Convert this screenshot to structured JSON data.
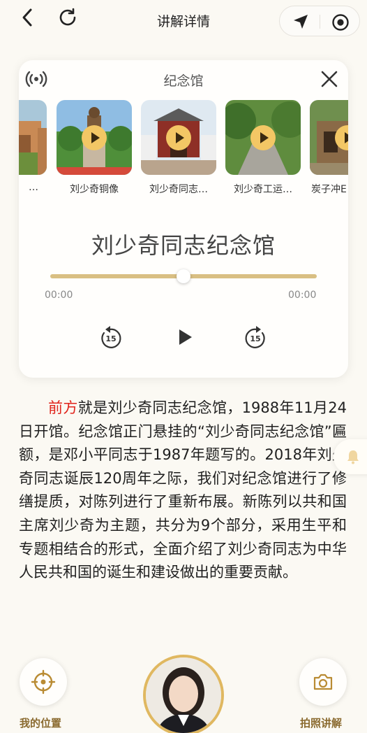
{
  "header": {
    "title": "讲解详情",
    "back_icon": "chevron-left-icon",
    "refresh_icon": "refresh-icon",
    "nav_icon": "navigation-arrow-icon",
    "target_icon": "record-target-icon"
  },
  "card": {
    "title": "纪念馆",
    "signal_icon": "broadcast-signal-icon",
    "close_icon": "close-icon",
    "thumbnails": [
      {
        "label": "…"
      },
      {
        "label": "刘少奇铜像"
      },
      {
        "label": "刘少奇同志…"
      },
      {
        "label": "刘少奇工运…"
      },
      {
        "label": "炭子冲E"
      }
    ],
    "player": {
      "track_name": "刘少奇同志纪念馆",
      "current_time": "00:00",
      "total_time": "00:00",
      "progress_fraction": 0.5,
      "rewind_label": "15",
      "forward_label": "15"
    }
  },
  "description": {
    "highlight": "前方",
    "text": "就是刘少奇同志纪念馆，1988年11月24日开馆。纪念馆正门悬挂的“刘少奇同志纪念馆”匾额，是邓小平同志于1987年题写的。2018年刘少奇同志诞辰120周年之际，我们对纪念馆进行了修缮提质，对陈列进行了重新布展。新陈列以共和国主席刘少奇为主题，共分为9个部分，采用生平和专题相结合的形式，全面介绍了刘少奇同志为中华人民共和国的诞生和建设做出的重要贡献。"
  },
  "bottom": {
    "location_label": "我的位置",
    "photo_label": "拍照讲解"
  },
  "colors": {
    "accent_gold": "#d9bf83",
    "label_brown": "#8a6a2f",
    "highlight_red": "#e0231b",
    "play_yellow": "#f3c765"
  }
}
